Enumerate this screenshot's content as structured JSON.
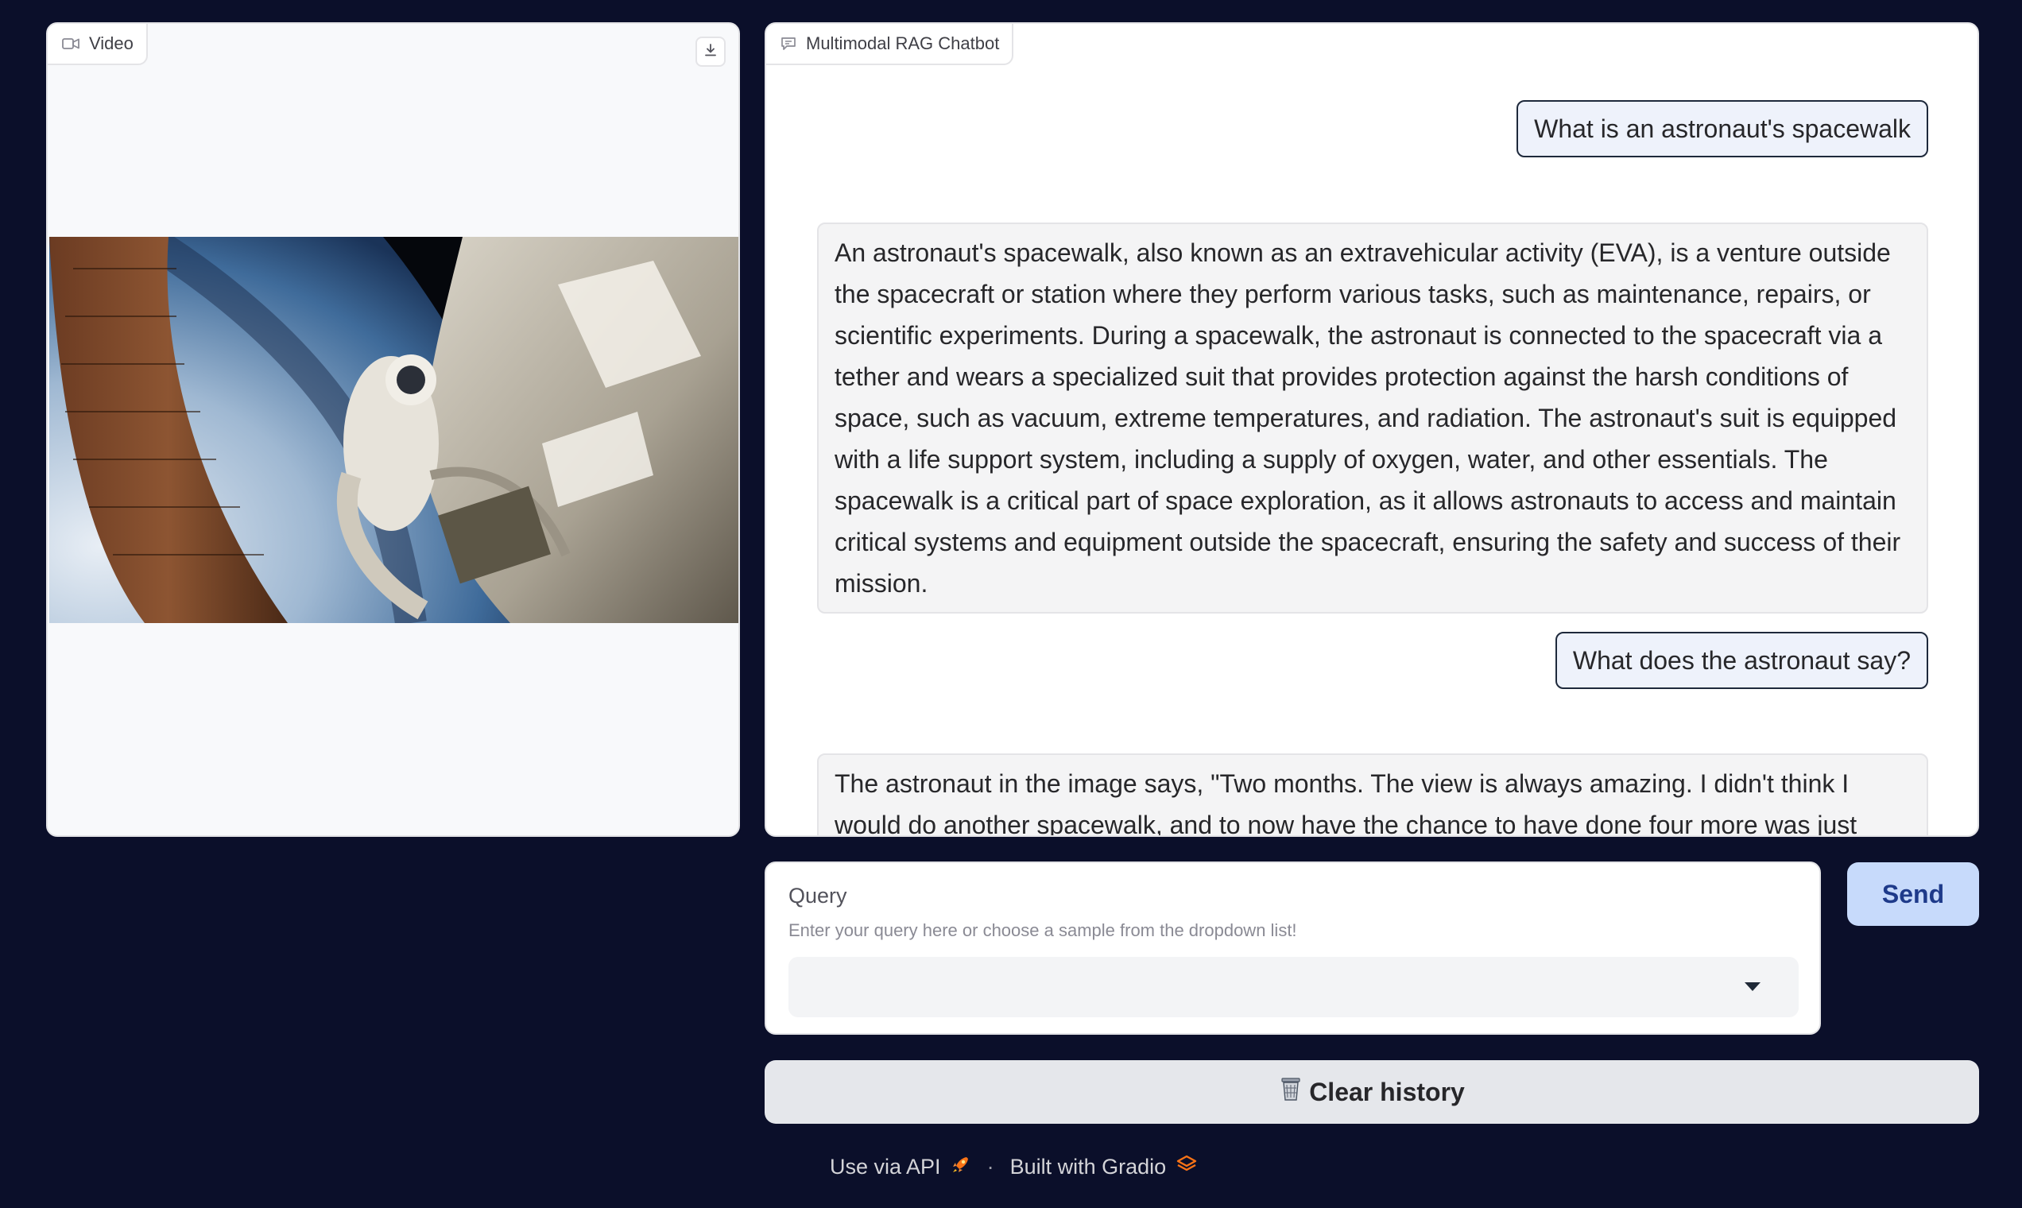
{
  "video_panel": {
    "label": "Video",
    "icon": "video-camera-icon",
    "download_icon": "download-icon"
  },
  "chat_panel": {
    "label": "Multimodal RAG Chatbot",
    "icon": "chat-bubble-icon",
    "messages": [
      {
        "role": "user",
        "text": "What is an astronaut's spacewalk"
      },
      {
        "role": "bot",
        "text": "An astronaut's spacewalk, also known as an extravehicular activity (EVA), is a venture outside the spacecraft or station where they perform various tasks, such as maintenance, repairs, or scientific experiments. During a spacewalk, the astronaut is connected to the spacecraft via a tether and wears a specialized suit that provides protection against the harsh conditions of space, such as vacuum, extreme temperatures, and radiation. The astronaut's suit is equipped with a life support system, including a supply of oxygen, water, and other essentials. The spacewalk is a critical part of space exploration, as it allows astronauts to access and maintain critical systems and equipment outside the spacecraft, ensuring the safety and success of their mission."
      },
      {
        "role": "user",
        "text": "What does the astronaut say?"
      },
      {
        "role": "bot",
        "text": "The astronaut in the image says, \"Two months. The view is always amazing. I didn't think I would do another spacewalk, and to now have the chance to have done four more was just icing on the cake for"
      }
    ]
  },
  "query": {
    "label": "Query",
    "info": "Enter your query here or choose a sample from the dropdown list!",
    "value": ""
  },
  "send_button": {
    "label": "Send"
  },
  "clear_button": {
    "label": "Clear history",
    "icon": "wastebasket-icon"
  },
  "footer": {
    "api_label": "Use via API",
    "separator": "·",
    "built_label": "Built with Gradio",
    "api_icon": "rocket-icon",
    "gradio_icon": "gradio-logo-icon"
  },
  "colors": {
    "background": "#0b0f2a",
    "send_button_bg": "#c7dafb",
    "send_button_text": "#1e3a8a",
    "user_bubble_bg": "#eef2fb",
    "bot_bubble_bg": "#f4f4f5"
  }
}
